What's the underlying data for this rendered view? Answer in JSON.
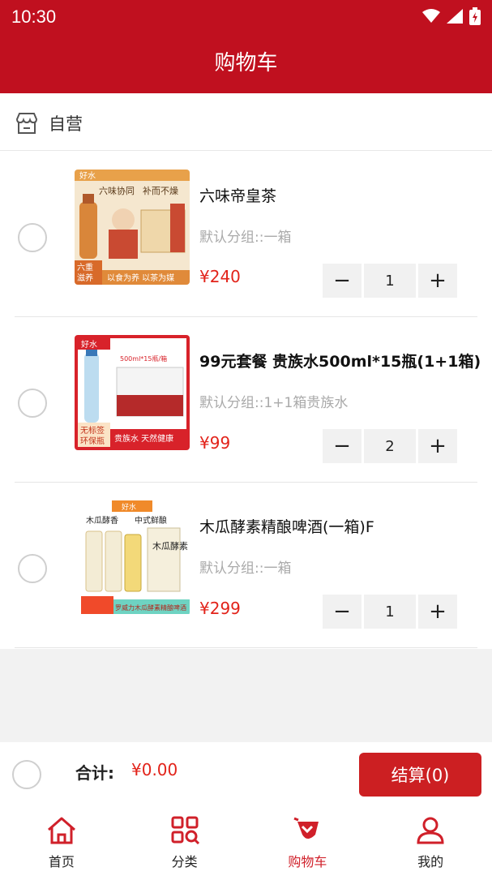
{
  "status_bar": {
    "time": "10:30"
  },
  "header": {
    "title": "购物车"
  },
  "store": {
    "name": "自营"
  },
  "items": [
    {
      "name": "六味帝皇茶",
      "group": "默认分组::一箱",
      "price": "¥240",
      "qty": "1",
      "thumb_text": {
        "brand": "好水",
        "slogan1": "六味协同",
        "slogan2": "补而不燥",
        "badge1": "六重",
        "badge2": "滋养",
        "footer": "以食为养 以茶为媒"
      }
    },
    {
      "name": "99元套餐 贵族水500ml*15瓶(1+1箱)",
      "group": "默认分组::1+1箱贵族水",
      "price": "¥99",
      "qty": "2",
      "thumb_text": {
        "brand": "好水",
        "spec": "500ml*15瓶/箱",
        "badge1": "无标签",
        "badge2": "环保瓶",
        "footer": "贵族水 天然健康"
      }
    },
    {
      "name": "木瓜酵素精酿啤酒(一箱)F",
      "group": "默认分组::一箱",
      "price": "¥299",
      "qty": "1",
      "thumb_text": {
        "brand": "好水",
        "slogan1": "木瓜酵香",
        "slogan2": "中式鲜酿",
        "can": "木瓜酵素",
        "footer": "罗威力木瓜酵素精酿啤酒"
      }
    }
  ],
  "checkout": {
    "total_label": "合计:",
    "total_value": "¥0.00",
    "button": "结算(0)"
  },
  "tabs": [
    {
      "label": "首页",
      "icon": "home-icon",
      "active": false
    },
    {
      "label": "分类",
      "icon": "category-icon",
      "active": false
    },
    {
      "label": "购物车",
      "icon": "cart-icon",
      "active": true
    },
    {
      "label": "我的",
      "icon": "profile-icon",
      "active": false
    }
  ],
  "colors": {
    "brand": "#c0101f",
    "price": "#e2231a",
    "pay_button": "#cc1f22"
  }
}
